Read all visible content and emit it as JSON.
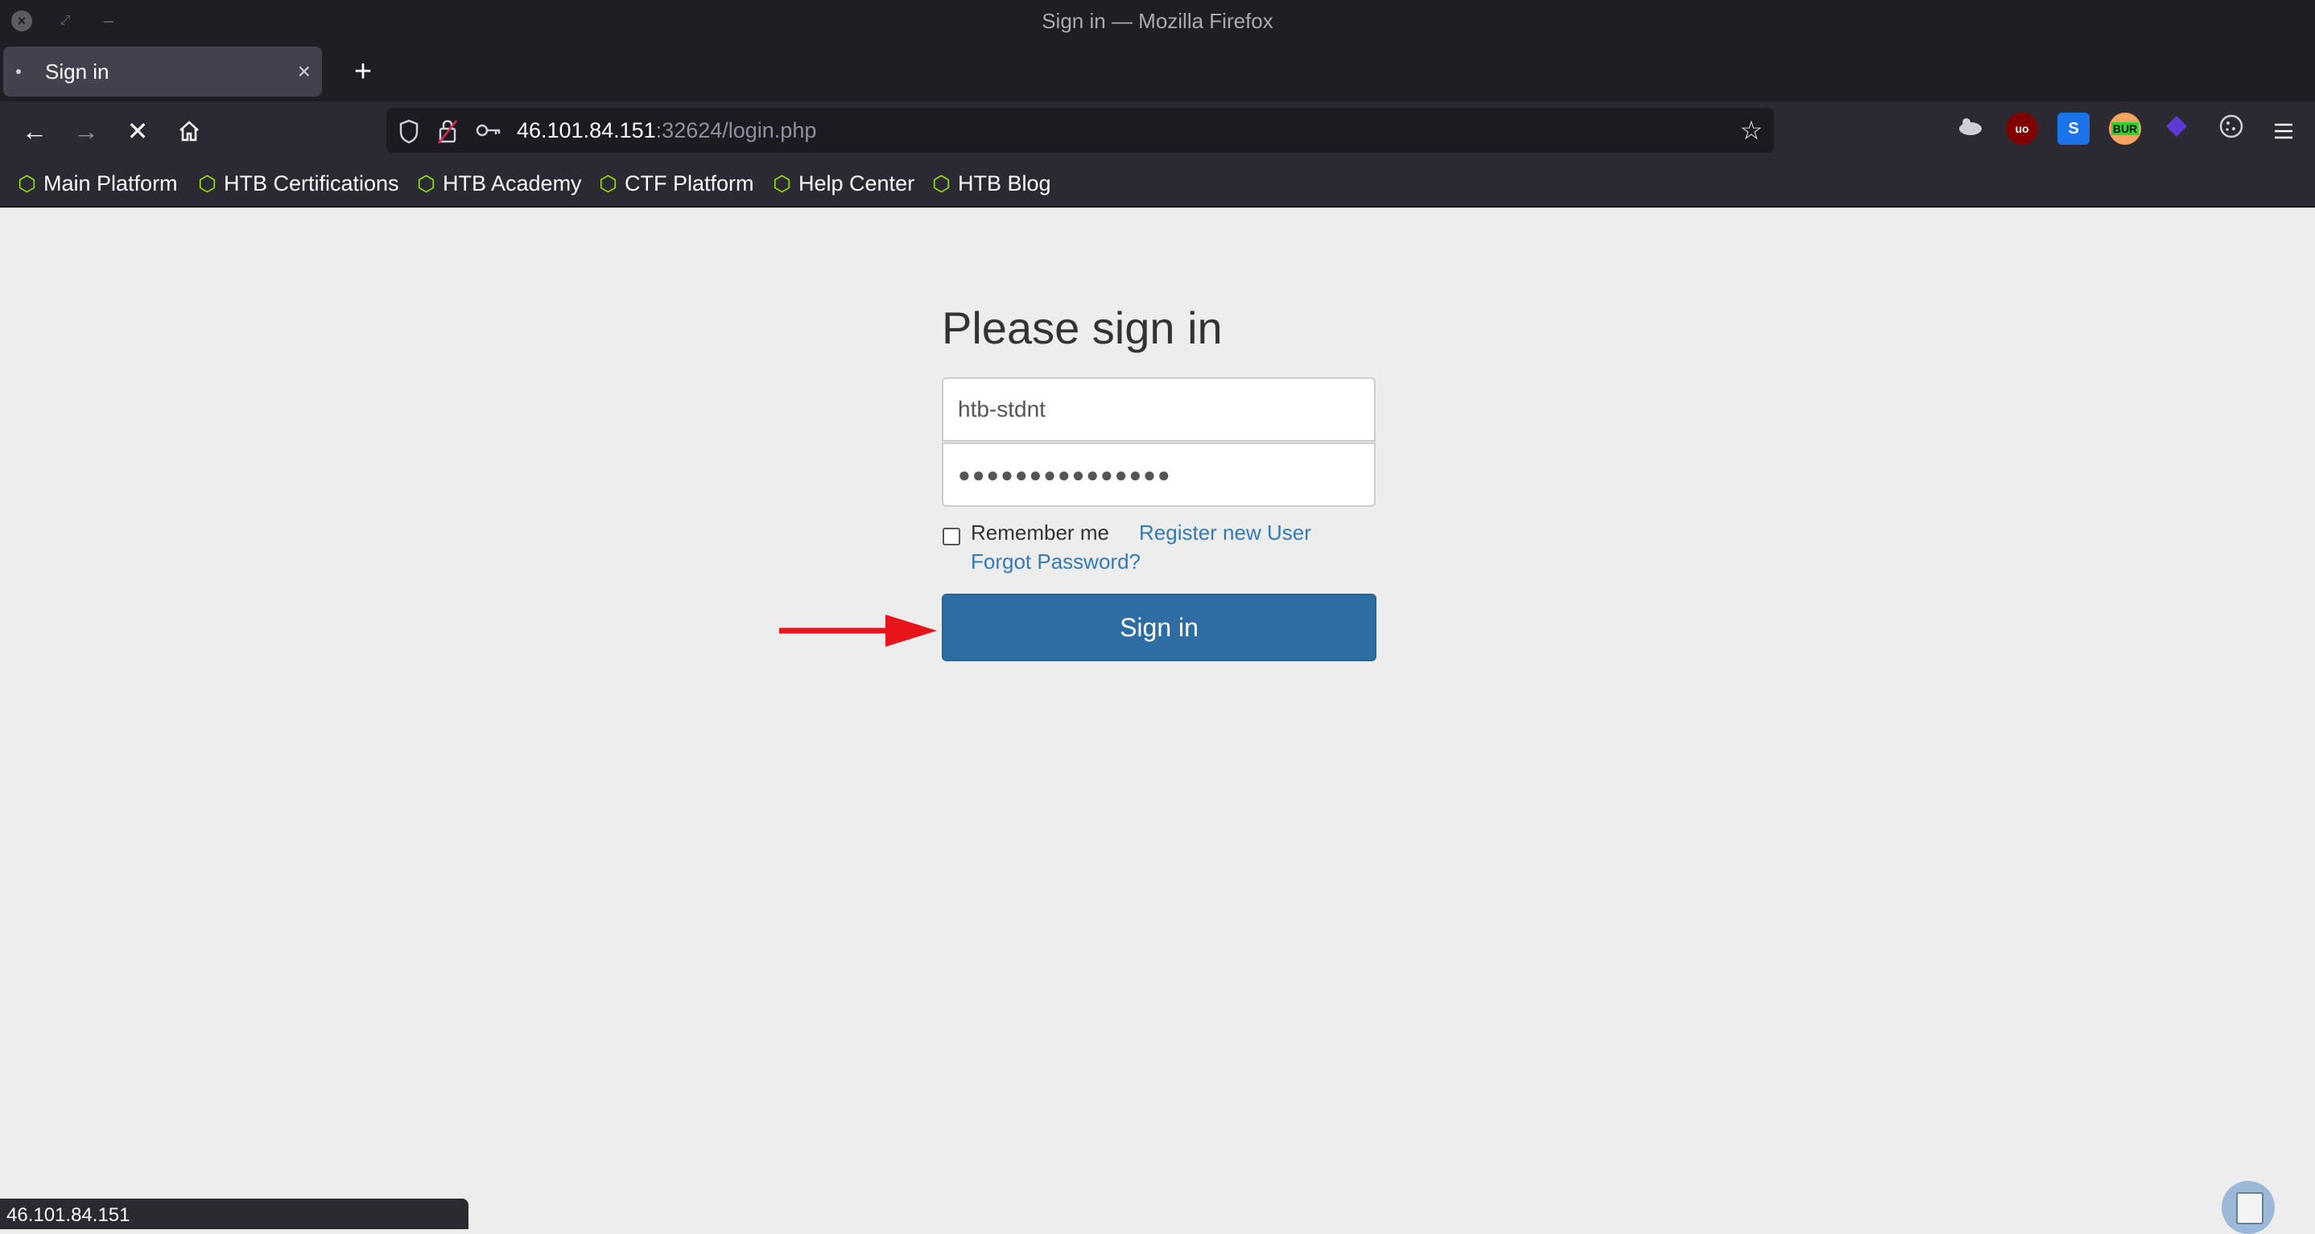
{
  "window": {
    "title": "Sign in — Mozilla Firefox"
  },
  "tab": {
    "title": "Sign in",
    "close_glyph": "×",
    "new_tab_glyph": "+"
  },
  "nav": {
    "back_glyph": "←",
    "forward_glyph": "→",
    "stop_glyph": "✕",
    "url_host": "46.101.84.151",
    "url_path": ":32624/login.php",
    "star_glyph": "☆"
  },
  "extensions": [
    {
      "name": "hackbar-icon",
      "label": ""
    },
    {
      "name": "ublock-icon",
      "label": "uo"
    },
    {
      "name": "s-extension-icon",
      "label": "S"
    },
    {
      "name": "burp-icon",
      "label": "BUR"
    },
    {
      "name": "diamond-extension-icon",
      "label": ""
    },
    {
      "name": "cookie-icon",
      "label": ""
    }
  ],
  "bookmarks": [
    "Main Platform",
    "HTB Certifications",
    "HTB Academy",
    "CTF Platform",
    "Help Center",
    "HTB Blog"
  ],
  "login": {
    "heading": "Please sign in",
    "username": "htb-stdnt",
    "password_mask": "●●●●●●●●●●●●●●●",
    "remember_label": "Remember me",
    "remember_checked": false,
    "register_link": "Register new User",
    "forgot_link": "Forgot Password?",
    "signin_label": "Sign in"
  },
  "status_bar": {
    "text": "46.101.84.151"
  },
  "colors": {
    "chrome_bg": "#2b2a33",
    "page_bg": "#ededed",
    "button_primary": "#2e6da4",
    "link": "#337ab7",
    "annotation_arrow": "#e8141b",
    "bookmark_icon": "#9fef00"
  }
}
